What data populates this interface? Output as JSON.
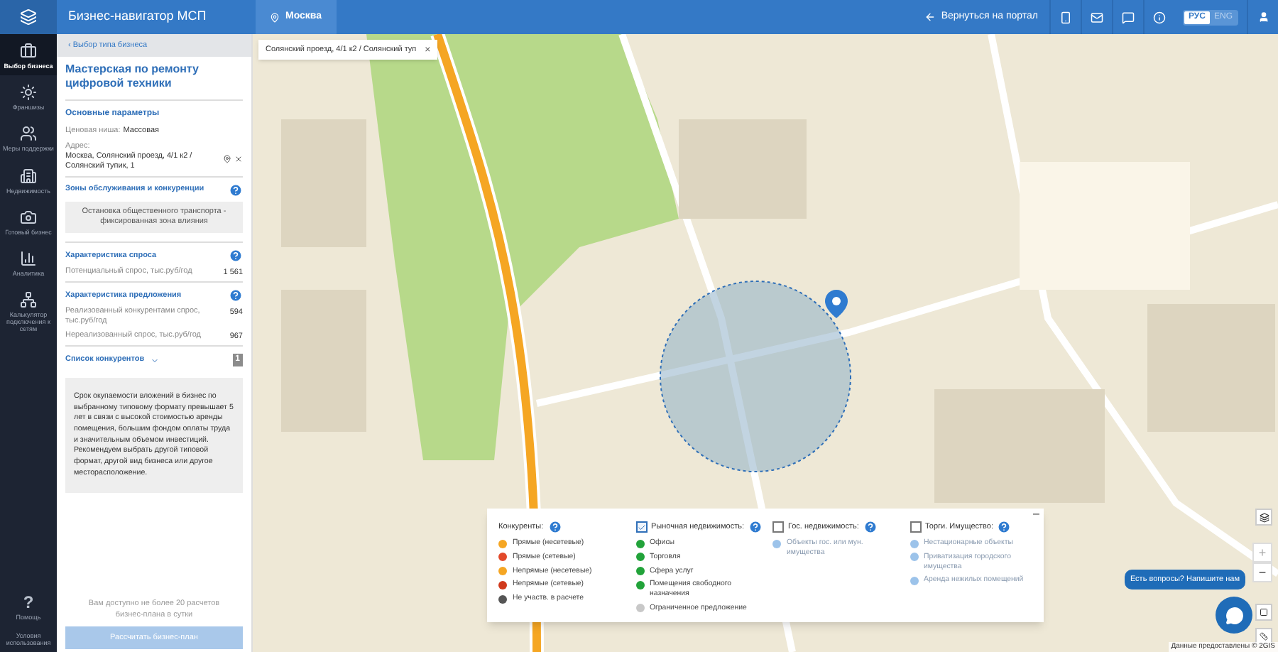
{
  "header": {
    "logo_title": "Бизнес-навигатор МСП",
    "city": "Москва",
    "back_link": "Вернуться на портал",
    "languages": [
      {
        "label": "РУС",
        "selected": true
      },
      {
        "label": "ENG",
        "selected": false
      }
    ]
  },
  "rail": {
    "items": [
      {
        "label": "Выбор бизнеса",
        "selected": true
      },
      {
        "label": "Франшизы",
        "selected": false
      },
      {
        "label": "Меры поддержки",
        "selected": false
      },
      {
        "label": "Недвижимость",
        "selected": false
      },
      {
        "label": "Готовый бизнес",
        "selected": false
      },
      {
        "label": "Аналитика",
        "selected": false
      },
      {
        "label": "Калькулятор подключения к сетям",
        "selected": false
      }
    ],
    "help": "?",
    "help_label": "Помощь",
    "terms": "Условия использования"
  },
  "panel": {
    "back": "‹ Выбор типа бизнеса",
    "title": "Мастерская по ремонту цифровой техники",
    "params_title": "Основные параметры",
    "niche_label": "Ценовая ниша:",
    "niche_value": "Массовая",
    "address_label": "Адрес:",
    "address_value": "Москва, Солянский проезд, 4/1 к2 / Солянский тупик, 1",
    "zones_title": "Зоны обслуживания и конкуренции",
    "zones_note": "Остановка общественного транспорта - фиксированная зона влияния",
    "sections": [
      {
        "title": "Характеристика спроса",
        "rows": [
          {
            "label": "Потенциальный спрос, тыс.руб/год",
            "value": "1 561"
          }
        ]
      },
      {
        "title": "Характеристика предложения",
        "rows": [
          {
            "label": "Реализованный конкурентами спрос, тыс.руб/год",
            "value": "594"
          },
          {
            "label": "Нереализованный спрос, тыс.руб/год",
            "value": "967"
          }
        ]
      }
    ],
    "competitors_title": "Список конкурентов",
    "competitors_count": "1",
    "competitors_expanded": false,
    "warning": "Срок окупаемости вложений в бизнес по выбранному типовому формату превышает 5 лет в связи с высокой стоимостью аренды помещения, большим фондом оплаты труда и значительным объемом инвестиций. Рекомендуем выбрать другой типовой формат, другой вид бизнеса или другое месторасположение.",
    "limit_note": "Вам доступно не более 20 расчетов бизнес-плана в сутки",
    "calc_button": "Рассчитать бизнес-план",
    "calc_disabled": true
  },
  "map": {
    "address_chip": "Солянский проезд, 4/1 к2 / Солянский туп",
    "chip_close": "×",
    "zoom_in": "+",
    "zoom_out": "−",
    "chat_prompt": "Есть вопросы? Напишите нам",
    "attribution": "Данные предоставлены © 2GIS"
  },
  "legend": {
    "minimize": "–",
    "groups": [
      {
        "title": "Конкуренты:",
        "kind": "plain",
        "items": [
          {
            "label": "Прямые (несетевые)",
            "color": "#f5a623"
          },
          {
            "label": "Прямые (сетевые)",
            "color": "#e2492a"
          },
          {
            "label": "Непрямые (несетевые)",
            "color": "#f5a623"
          },
          {
            "label": "Непрямые (сетевые)",
            "color": "#d0391c"
          },
          {
            "label": "Не участв. в расчете",
            "color": "#555555"
          }
        ]
      },
      {
        "title": "Рыночная недвижимость:",
        "kind": "checkbox",
        "checked": true,
        "items": [
          {
            "label": "Офисы",
            "color": "#22a33a"
          },
          {
            "label": "Торговля",
            "color": "#22a33a"
          },
          {
            "label": "Сфера услуг",
            "color": "#22a33a"
          },
          {
            "label": "Помещения свободного назначения",
            "color": "#22a33a"
          },
          {
            "label": "Ограниченное предложение",
            "color": "#c8c8c8"
          }
        ]
      },
      {
        "title": "Гос. недвижимость:",
        "kind": "checkbox",
        "checked": false,
        "items": [
          {
            "label": "Объекты гос. или мун. имущества",
            "color": "#9cc3ea"
          }
        ]
      },
      {
        "title": "Торги. Имущество:",
        "kind": "checkbox",
        "checked": false,
        "items": [
          {
            "label": "Нестационарные объекты",
            "color": "#9cc3ea"
          },
          {
            "label": "Приватизация городского имущества",
            "color": "#9cc3ea"
          },
          {
            "label": "Аренда нежилых помещений",
            "color": "#9cc3ea"
          }
        ]
      }
    ]
  }
}
